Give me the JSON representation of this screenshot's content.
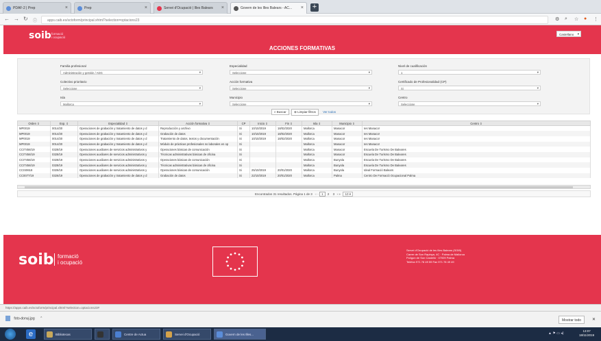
{
  "browser": {
    "tabs": [
      {
        "label": "PDAF-2 | Prep",
        "favicon_color": "#5b8dd9"
      },
      {
        "label": "Prep",
        "favicon_color": "#5b8dd9"
      },
      {
        "label": "Servei d'Ocupació | Illes Balears",
        "favicon_color": "#e4354d"
      },
      {
        "label": "Govern de les Illes Balears - AC...",
        "favicon_color": "#555555"
      }
    ],
    "url": "apps.caib.es/sctoform/principal.xhtml?selection=optacions23",
    "status_url": "https://apps.caib.es/sctoform/principal.xhtml?selection=optacions23#"
  },
  "header": {
    "logo": "soib",
    "logo_sub": [
      "formació",
      "i ocupació"
    ],
    "language": "Castellano",
    "title": "ACCIONES FORMATIVAS",
    "brand_color": "#e4354d"
  },
  "filters": [
    {
      "label": "Familia profesional",
      "value": "Administración y gestión / ADG"
    },
    {
      "label": "Especialidad",
      "value": "Seleccione"
    },
    {
      "label": "Nivel de cualificación",
      "value": "1"
    },
    {
      "label": "Colectivo prioritario",
      "value": "Seleccione"
    },
    {
      "label": "Acción formativa",
      "value": "Seleccione"
    },
    {
      "label": "Certificado de Profesionalidad (CP)",
      "value": "Si"
    },
    {
      "label": "Isla",
      "value": "Mallorca"
    },
    {
      "label": "Municipio",
      "value": "Seleccione"
    },
    {
      "label": "Centro",
      "value": "Seleccione"
    }
  ],
  "filter_buttons": [
    "Buscar",
    "Limpiar filtros",
    "Ver todos"
  ],
  "table": {
    "columns": [
      "Orden",
      "Exp.",
      "Especialidad",
      "Acción formativa",
      "CP",
      "Inicio",
      "Fin",
      "Isla",
      "Municipio",
      "Centro"
    ],
    "rows": [
      [
        "MP0019",
        "0014/20",
        "Operaciones de grabación y tratamiento de datos y d",
        "Reproducción y archivo",
        "Si",
        "10/10/2019",
        "18/02/2020",
        "Mallorca",
        "Manacor",
        "Ies Manacor"
      ],
      [
        "MP0019",
        "0014/20",
        "Operaciones de grabación y tratamiento de datos y d",
        "Grabación de datos",
        "Si",
        "10/10/2019",
        "18/02/2020",
        "Mallorca",
        "Manacor",
        "Ies Manacor"
      ],
      [
        "MP0019",
        "0014/20",
        "Operaciones de grabación y tratamiento de datos y d",
        "Tratamiento de datos, textos y documentación",
        "Si",
        "10/10/2019",
        "18/02/2020",
        "Mallorca",
        "Manacor",
        "Ies Manacor"
      ],
      [
        "MP0019",
        "0014/20",
        "Operaciones de grabación y tratamiento de datos y d",
        "Módulo de prácticas profesionales no laborales en op",
        "Si",
        "",
        "",
        "Mallorca",
        "Manacor",
        "Ies Manacor"
      ],
      [
        "CCIT456/19",
        "0328/19",
        "Operaciones auxiliares de servicios administrativos y",
        "Operaciones básicas de comunicación",
        "Si",
        "",
        "",
        "Mallorca",
        "Manacor",
        "Escuela De Turismo De Baleares"
      ],
      [
        "CCIT456/19",
        "0328/19",
        "Operaciones auxiliares de servicios administrativos y",
        "Técnicas administrativas básicas de oficina",
        "Si",
        "",
        "",
        "Mallorca",
        "Manacor",
        "Escuela De Turismo De Baleares"
      ],
      [
        "CCIT456/19",
        "0328/19",
        "Operaciones auxiliares de servicios administrativos y",
        "Operaciones básicas de comunicación",
        "Si",
        "",
        "",
        "Mallorca",
        "Bunyola",
        "Escuela De Turismo De Baleares"
      ],
      [
        "CCIT456/19",
        "0328/19",
        "Operaciones auxiliares de servicios administrativos y",
        "Técnicas administrativas básicas de oficina",
        "Si",
        "",
        "",
        "Mallorca",
        "Bunyola",
        "Escuela De Turismo De Baleares"
      ],
      [
        "CCIS0618",
        "0326/19",
        "Operaciones auxiliares de servicios administrativos y",
        "Operaciones básicas de comunicación",
        "Si",
        "25/10/2019",
        "20/01/2020",
        "Mallorca",
        "Bunyola",
        "Ideal Formació Balears"
      ],
      [
        "CC0077/19",
        "0326/19",
        "Operaciones de grabación y tratamiento de datos y d",
        "Grabación de datos",
        "Si",
        "22/10/2019",
        "20/01/2020",
        "Mallorca",
        "Palma",
        "Centro De Formació Ocupacional Palma"
      ]
    ]
  },
  "pager": {
    "summary": "Encontrados 31 resultados. Página 1 de 3",
    "pages": [
      "1",
      "2",
      "3"
    ],
    "page_size": "10"
  },
  "footer": {
    "logo": "soib",
    "logo_sub": [
      "formació",
      "i ocupació"
    ],
    "contact": [
      "Servei d'Ocupació de les Illes Balears (SOIB)",
      "Carrer de Son Rapinya, 4C · Palma de Mallorca",
      "Polígon de Son Castelló · 07009 Palma",
      "Telèfon 971 78 49 59 Fax 971 78 49 49"
    ]
  },
  "download_bar": {
    "file": "foto-donuj.jpg",
    "show_all": "Mostrar todo",
    "close": "✕"
  },
  "taskbar": {
    "apps": [
      {
        "label": "Bibliotecas",
        "color": "#c9a95a"
      },
      {
        "label": "",
        "color": "#333333"
      },
      {
        "label": "Centre de Actua",
        "color": "#4b7fd1"
      },
      {
        "label": "Servei d'Ocupació",
        "color": "#d4a24a"
      },
      {
        "label": "Govern de les Illes...",
        "color": "#5b8dd9"
      }
    ],
    "time": "13:07",
    "date": "18/11/2019"
  }
}
